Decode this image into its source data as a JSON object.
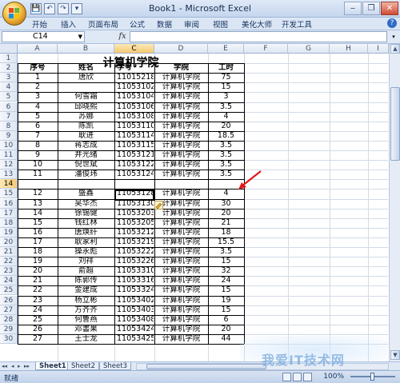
{
  "window": {
    "title": "Book1 - Microsoft Excel",
    "minimize": "‒",
    "maximize": "❐",
    "close": "✕"
  },
  "quick_access": [
    "💾",
    "↶",
    "↷",
    "▾"
  ],
  "ribbon": {
    "tabs": [
      "开始",
      "插入",
      "页面布局",
      "公式",
      "数据",
      "审阅",
      "视图",
      "美化大师",
      "开发工具"
    ],
    "help": "?"
  },
  "formula_bar": {
    "name_box": "C14",
    "fx_label": "fx",
    "formula": ""
  },
  "columns": [
    "A",
    "B",
    "C",
    "D",
    "E",
    "F",
    "G",
    "H",
    "I"
  ],
  "selected_cell": "C14",
  "sheet_title": "计算机学院",
  "headers": [
    "序号",
    "姓名",
    "学号",
    "学院",
    "工时"
  ],
  "rows": [
    {
      "row": "1",
      "cells": [
        "",
        "",
        "",
        "",
        ""
      ]
    },
    {
      "row": "2",
      "cells": [
        "序号",
        "姓名",
        "学号",
        "学院",
        "工时"
      ]
    },
    {
      "row": "3",
      "cells": [
        "1",
        "唐欣",
        "11015218",
        "计算机学院",
        "75"
      ]
    },
    {
      "row": "4",
      "cells": [
        "2",
        "",
        "11053102",
        "计算机学院",
        "15"
      ]
    },
    {
      "row": "5",
      "cells": [
        "3",
        "何雪霜",
        "11053104",
        "计算机学院",
        "3"
      ]
    },
    {
      "row": "6",
      "cells": [
        "4",
        "邱晓熙",
        "11053106",
        "计算机学院",
        "3.5"
      ]
    },
    {
      "row": "7",
      "cells": [
        "5",
        "苏娜",
        "11053108",
        "计算机学院",
        "4"
      ]
    },
    {
      "row": "8",
      "cells": [
        "6",
        "陈凯",
        "11053110",
        "计算机学院",
        "20"
      ]
    },
    {
      "row": "9",
      "cells": [
        "7",
        "耿进",
        "11053114",
        "计算机学院",
        "18.5"
      ]
    },
    {
      "row": "10",
      "cells": [
        "8",
        "蒋志成",
        "11053115",
        "计算机学院",
        "3.5"
      ]
    },
    {
      "row": "11",
      "cells": [
        "9",
        "井光绪",
        "11053121",
        "计算机学院",
        "3.5"
      ]
    },
    {
      "row": "12",
      "cells": [
        "10",
        "倪世斌",
        "11053122",
        "计算机学院",
        "3.5"
      ]
    },
    {
      "row": "13",
      "cells": [
        "11",
        "潘俊玮",
        "11053124",
        "计算机学院",
        "3.5"
      ]
    },
    {
      "row": "14",
      "cells": [
        "",
        "",
        "",
        "",
        ""
      ]
    },
    {
      "row": "15",
      "cells": [
        "12",
        "盛鑫",
        "11053128",
        "计算机学院",
        "4"
      ]
    },
    {
      "row": "16",
      "cells": [
        "13",
        "吴华杰",
        "11053130",
        "计算机学院",
        "30"
      ]
    },
    {
      "row": "17",
      "cells": [
        "14",
        "徐锡健",
        "11053203",
        "计算机学院",
        "20"
      ]
    },
    {
      "row": "18",
      "cells": [
        "15",
        "钱红林",
        "11053205",
        "计算机学院",
        "21"
      ]
    },
    {
      "row": "19",
      "cells": [
        "16",
        "唐焕纤",
        "11053212",
        "计算机学院",
        "18"
      ]
    },
    {
      "row": "20",
      "cells": [
        "17",
        "耿家利",
        "11053219",
        "计算机学院",
        "15.5"
      ]
    },
    {
      "row": "21",
      "cells": [
        "18",
        "操永彪",
        "11053222",
        "计算机学院",
        "3.5"
      ]
    },
    {
      "row": "22",
      "cells": [
        "19",
        "刘祥",
        "11053226",
        "计算机学院",
        "15"
      ]
    },
    {
      "row": "23",
      "cells": [
        "20",
        "俞超",
        "11053310",
        "计算机学院",
        "32"
      ]
    },
    {
      "row": "24",
      "cells": [
        "21",
        "陈郭传",
        "11053316",
        "计算机学院",
        "24"
      ]
    },
    {
      "row": "25",
      "cells": [
        "22",
        "金建成",
        "11053324",
        "计算机学院",
        "15"
      ]
    },
    {
      "row": "26",
      "cells": [
        "23",
        "杨立彬",
        "11053402",
        "计算机学院",
        "19"
      ]
    },
    {
      "row": "27",
      "cells": [
        "24",
        "方齐齐",
        "11053403",
        "计算机学院",
        "15"
      ]
    },
    {
      "row": "28",
      "cells": [
        "25",
        "何鲁燕",
        "11053408",
        "计算机学院",
        "6"
      ]
    },
    {
      "row": "29",
      "cells": [
        "26",
        "邓書果",
        "11053424",
        "计算机学院",
        "20"
      ]
    },
    {
      "row": "30",
      "cells": [
        "27",
        "王士龙",
        "11053425",
        "计算机学院",
        "44"
      ]
    }
  ],
  "sheets": [
    "Sheet1",
    "Sheet2",
    "Sheet3"
  ],
  "active_sheet": "Sheet1",
  "sheet_nav": [
    "◂◂",
    "◂",
    "▸",
    "▸▸"
  ],
  "status": {
    "mode": "就绪",
    "zoom": "100%"
  },
  "watermark": "我爱IT技术网",
  "colors": {
    "accent": "#3c64b4",
    "arrow": "#e01818",
    "selection_header": "#f5c873"
  }
}
